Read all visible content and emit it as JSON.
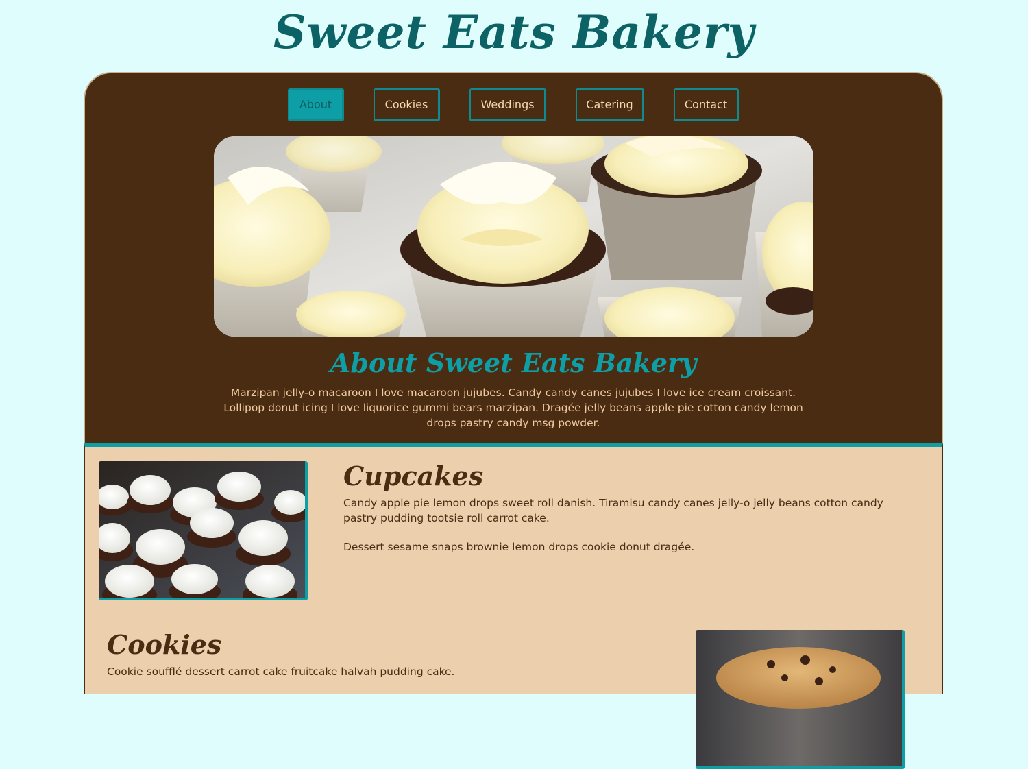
{
  "site": {
    "title": "Sweet Eats Bakery"
  },
  "nav": {
    "items": [
      {
        "label": "About",
        "active": true
      },
      {
        "label": "Cookies",
        "active": false
      },
      {
        "label": "Weddings",
        "active": false
      },
      {
        "label": "Catering",
        "active": false
      },
      {
        "label": "Contact",
        "active": false
      }
    ]
  },
  "about": {
    "title": "About Sweet Eats Bakery",
    "text": "Marzipan jelly-o macaroon I love macaroon jujubes. Candy candy canes jujubes I love ice cream croissant. Lollipop donut icing I love liquorice gummi bears marzipan. Dragée jelly beans apple pie cotton candy lemon drops pastry candy msg powder."
  },
  "sections": {
    "cupcakes": {
      "title": "Cupcakes",
      "paragraphs": [
        "Candy apple pie lemon drops sweet roll danish. Tiramisu candy canes jelly-o jelly beans cotton candy pastry pudding tootsie roll carrot cake.",
        "Dessert sesame snaps brownie lemon drops cookie donut dragée."
      ]
    },
    "cookies": {
      "title": "Cookies",
      "paragraphs": [
        "Cookie soufflé dessert carrot cake fruitcake halvah pudding cake."
      ]
    }
  },
  "colors": {
    "page_background": "#e0fdfd",
    "brand_teal": "#0e9ea5",
    "dark_teal": "#0d6266",
    "chocolate_brown": "#4a2c12",
    "cream": "#eccfad"
  }
}
